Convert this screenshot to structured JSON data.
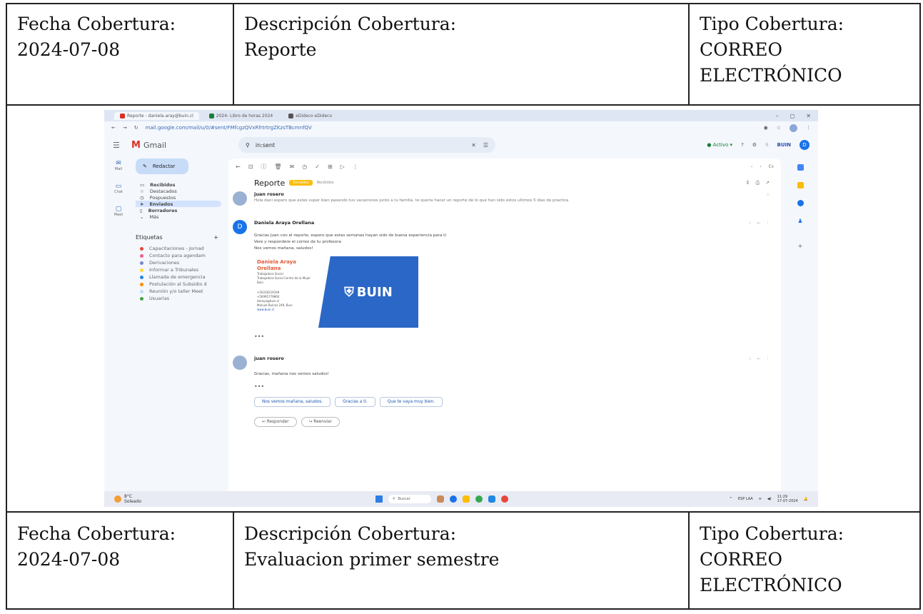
{
  "top_row": {
    "fecha_label": "Fecha Cobertura:",
    "fecha_value": "2024-07-08",
    "desc_label": "Descripción Cobertura:",
    "desc_value": "Reporte",
    "tipo_label": "Tipo Cobertura:",
    "tipo_value_1": "CORREO",
    "tipo_value_2": "ELECTRÓNICO"
  },
  "bottom_row": {
    "fecha_label": "Fecha Cobertura:",
    "fecha_value": "2024-07-08",
    "desc_label": "Descripción Cobertura:",
    "desc_value": "Evaluacion primer semestre",
    "tipo_label": "Tipo Cobertura:",
    "tipo_value_1": "CORREO",
    "tipo_value_2": "ELECTRÓNICO"
  },
  "screenshot": {
    "tabs": [
      "Reporte - daniela.aray@buin.cl",
      "2024- Libro de horas 2024",
      "eDideco eDideco"
    ],
    "url": "mail.google.com/mail/u/0/#sent/FMfcgzQVxRfrtrtrgZKzsTBcmnfQV",
    "app_name": "Gmail",
    "search_value": "in:sent",
    "status": "Activo",
    "org_logo": "BUIN",
    "avatar_letter": "D",
    "rail": [
      "Mail",
      "Chat",
      "Meet"
    ],
    "compose": "Redactar",
    "nav_items": [
      "Recibidos",
      "Destacados",
      "Pospuestos",
      "Enviados",
      "Borradores",
      "Más"
    ],
    "labels_header": "Etiquetas",
    "labels": [
      {
        "name": "Capacitaciones - Jornad",
        "color": "#e8453c"
      },
      {
        "name": "Contacto para agendam",
        "color": "#f06292"
      },
      {
        "name": "Derivaciones",
        "color": "#7986cb"
      },
      {
        "name": "Informar a Tribunales",
        "color": "#fdd835"
      },
      {
        "name": "Llamada de emergencia",
        "color": "#1e88e5"
      },
      {
        "name": "Postulación al Subsidio d",
        "color": "#fb8c00"
      },
      {
        "name": "Reunión y/o taller Meet",
        "color": "#bbdefb"
      },
      {
        "name": "Usuarias",
        "color": "#43a047"
      }
    ],
    "pagination": "Ex",
    "subject": "Reporte",
    "subject_chip": "Enviados",
    "subject_chip2": "Recibidos",
    "messages": [
      {
        "sender": "juan rosero",
        "snippet": "Hola dani espero que estes super bien pasando tus vacaciones junto a tu familia. te queria hacer un reporte de lo que han sido estos ultimos 5 dias de practica"
      },
      {
        "sender": "Daniela Araya Orellana",
        "avatar": "D",
        "lines": [
          "Gracias Juan con el reporte, espero que estas semanas hayan sido de buena experiencia para ti",
          "Vere y respondere el correo de tu profesora",
          "Nos vemos mañana, saludos!"
        ],
        "signature": {
          "name": "Daniela Araya Orellana",
          "role": "Trabajadora Social",
          "unit": "Trabajadora Social Centro de la Mujer Buin",
          "phone1": "+56228219349",
          "phone2": "+56995779860",
          "email": "daraya@buin.cl",
          "address": "Manuel Bulnes 249, Buin",
          "web": "www.buin.cl",
          "logo": "BUIN"
        }
      },
      {
        "sender": "juan rosero",
        "lines": [
          "Gracias, mañana nos vemos saludos!"
        ]
      }
    ],
    "smart_replies": [
      "Nos vemos mañana, saludos.",
      "Gracias a ti.",
      "Que te vaya muy bien."
    ],
    "reply_buttons": [
      "Responder",
      "Reenviar"
    ],
    "taskbar": {
      "weather": "8°C",
      "weather_desc": "Soleado",
      "search": "Buscar",
      "lang": "ESP LAA",
      "time": "11:29",
      "date": "17-07-2024"
    }
  },
  "colors": {
    "gmail_blue": "#1a73e8",
    "buin_blue": "#2b67c7"
  }
}
